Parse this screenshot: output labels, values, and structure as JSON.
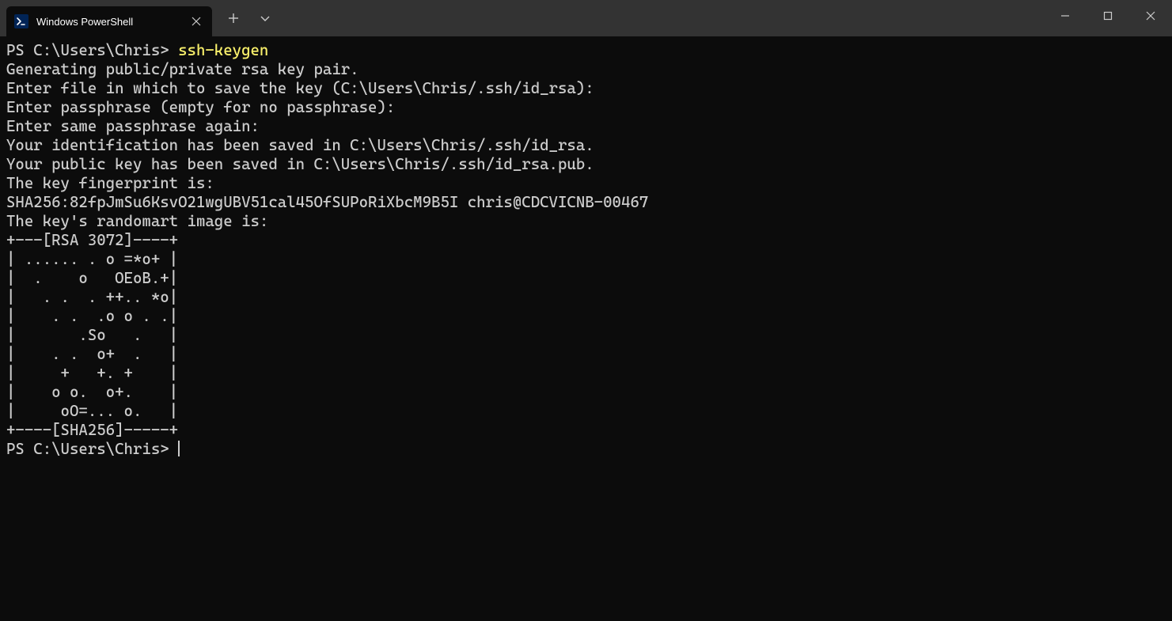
{
  "titlebar": {
    "tab": {
      "title": "Windows PowerShell",
      "icon_glyph": ">_"
    }
  },
  "terminal": {
    "prompt1": "PS C:\\Users\\Chris> ",
    "command1": "ssh-keygen",
    "lines": [
      "Generating public/private rsa key pair.",
      "Enter file in which to save the key (C:\\Users\\Chris/.ssh/id_rsa):",
      "Enter passphrase (empty for no passphrase):",
      "Enter same passphrase again:",
      "Your identification has been saved in C:\\Users\\Chris/.ssh/id_rsa.",
      "Your public key has been saved in C:\\Users\\Chris/.ssh/id_rsa.pub.",
      "The key fingerprint is:",
      "SHA256:82fpJmSu6KsvO21wgUBV51cal45OfSUPoRiXbcM9B5I chris@CDCVICNB-00467",
      "The key's randomart image is:",
      "+---[RSA 3072]----+",
      "| ...... . o =*o+ |",
      "|  .    o   OEoB.+|",
      "|   . .  . ++.. *o|",
      "|    . .  .o o . .|",
      "|       .So   .   |",
      "|    . .  o+  .   |",
      "|     +   +. +    |",
      "|    o o.  o+.    |",
      "|     oO=... o.   |",
      "+----[SHA256]-----+"
    ],
    "prompt2": "PS C:\\Users\\Chris> "
  }
}
